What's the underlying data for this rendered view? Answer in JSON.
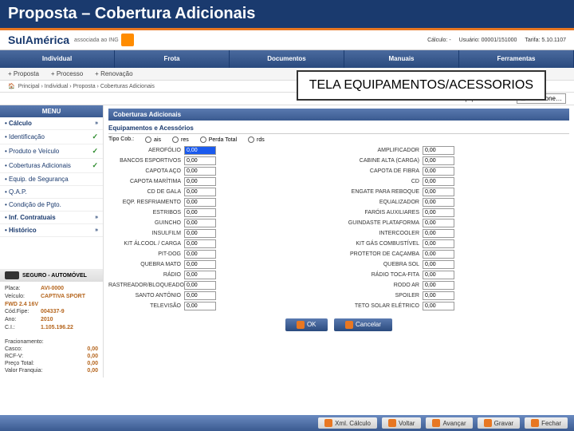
{
  "title": "Proposta – Cobertura Adicionais",
  "logo": "SulAmérica",
  "logo_sub": "associada ao ING",
  "topinfo": {
    "calc": "Cálculo: -",
    "user": "Usuário: 00001/151000",
    "tarifa": "Tarifa: 5.10.1107"
  },
  "tabs": [
    "Individual",
    "Frota",
    "Documentos",
    "Manuais",
    "Ferramentas"
  ],
  "subnav": [
    "+ Proposta",
    "+ Processo",
    "+ Renovação"
  ],
  "breadcrumb": "Principal › Individual › Proposta › Coberturas Adicionais",
  "equip_label": "Equip./Acessórios:",
  "equip_sel": "Selecione…",
  "menu_hdr": "MENU",
  "menu": [
    {
      "label": "Cálculo",
      "arrow": true,
      "bold": true
    },
    {
      "label": "Identificação",
      "check": true
    },
    {
      "label": "Produto e Veículo",
      "check": true
    },
    {
      "label": "Coberturas Adicionais",
      "check": true
    },
    {
      "label": "Equip. de Segurança"
    },
    {
      "label": "Q.A.P."
    },
    {
      "label": "Condição de Pgto."
    },
    {
      "label": "Inf. Contratuais",
      "arrow": true,
      "bold": true
    },
    {
      "label": "Histórico",
      "arrow": true,
      "bold": true
    }
  ],
  "seguro_hdr": "SEGURO - AUTOMÓVEL",
  "seguro": {
    "placa_l": "Placa:",
    "placa": "AVI-0000",
    "veic_l": "Veículo:",
    "veic": "CAPTIVA SPORT FWD 2.4 16V",
    "fipe_l": "Cód.Fipe:",
    "fipe": "004337-9",
    "ano_l": "Ano:",
    "ano": "2010",
    "ci_l": "C.I.:",
    "ci": "1.105.196.22"
  },
  "totals": {
    "t1_l": "Fracionamento:",
    "t1": "",
    "t2_l": "Casco:",
    "t2": "0,00",
    "t3_l": "RCF-V:",
    "t3": "0,00",
    "t4_l": "Preço Total:",
    "t4": "0,00",
    "t5_l": "Valor Franquia:",
    "t5": "0,00"
  },
  "content_hdr": "Coberturas Adicionais",
  "content_sub": "Equipamentos e Acessórios",
  "tipo_lbl": "Tipo Cob.:",
  "tipos": [
    "ais",
    "res",
    "Perda Total",
    "rds"
  ],
  "left_items": [
    {
      "n": "AEROFÓLIO",
      "v": "0,00",
      "a": true
    },
    {
      "n": "BANCOS ESPORTIVOS",
      "v": "0,00"
    },
    {
      "n": "CAPOTA AÇO",
      "v": "0,00"
    },
    {
      "n": "CAPOTA MARÍTIMA",
      "v": "0,00"
    },
    {
      "n": "CD DE GALA",
      "v": "0,00"
    },
    {
      "n": "EQP. RESFRIAMENTO",
      "v": "0,00"
    },
    {
      "n": "ESTRIBOS",
      "v": "0,00"
    },
    {
      "n": "GUINCHO",
      "v": "0,00"
    },
    {
      "n": "INSULFILM",
      "v": "0,00"
    },
    {
      "n": "KIT ÁLCOOL / CARGA",
      "v": "0,00"
    },
    {
      "n": "PIT-DOG",
      "v": "0,00"
    },
    {
      "n": "QUEBRA MATO",
      "v": "0,00"
    },
    {
      "n": "RÁDIO",
      "v": "0,00"
    },
    {
      "n": "RASTREADOR/BLOQUEADOR",
      "v": "0,00"
    },
    {
      "n": "SANTO ANTÔNIO",
      "v": "0,00"
    },
    {
      "n": "TELEVISÃO",
      "v": "0,00"
    }
  ],
  "right_items": [
    {
      "n": "AMPLIFICADOR",
      "v": "0,00"
    },
    {
      "n": "CABINE ALTA (CARGA)",
      "v": "0,00"
    },
    {
      "n": "CAPOTA DE FIBRA",
      "v": "0,00"
    },
    {
      "n": "CD",
      "v": "0,00"
    },
    {
      "n": "ENGATE PARA REBOQUE",
      "v": "0,00"
    },
    {
      "n": "EQUALIZADOR",
      "v": "0,00"
    },
    {
      "n": "FARÓIS AUXILIARES",
      "v": "0,00"
    },
    {
      "n": "GUINDASTE PLATAFORMA",
      "v": "0,00"
    },
    {
      "n": "INTERCOOLER",
      "v": "0,00"
    },
    {
      "n": "KIT GÁS COMBUSTÍVEL",
      "v": "0,00"
    },
    {
      "n": "PROTETOR DE CAÇAMBA",
      "v": "0,00"
    },
    {
      "n": "QUEBRA SOL",
      "v": "0,00"
    },
    {
      "n": "RÁDIO TOCA-FITA",
      "v": "0,00"
    },
    {
      "n": "RODO AR",
      "v": "0,00"
    },
    {
      "n": "SPOILER",
      "v": "0,00"
    },
    {
      "n": "TETO SOLAR ELÉTRICO",
      "v": "0,00"
    }
  ],
  "btn_ok": "OK",
  "btn_cancel": "Cancelar",
  "callout": "TELA EQUIPAMENTOS/ACESSORIOS",
  "bottom": [
    "Xml. Cálculo",
    "Voltar",
    "Avançar",
    "Gravar",
    "Fechar"
  ]
}
